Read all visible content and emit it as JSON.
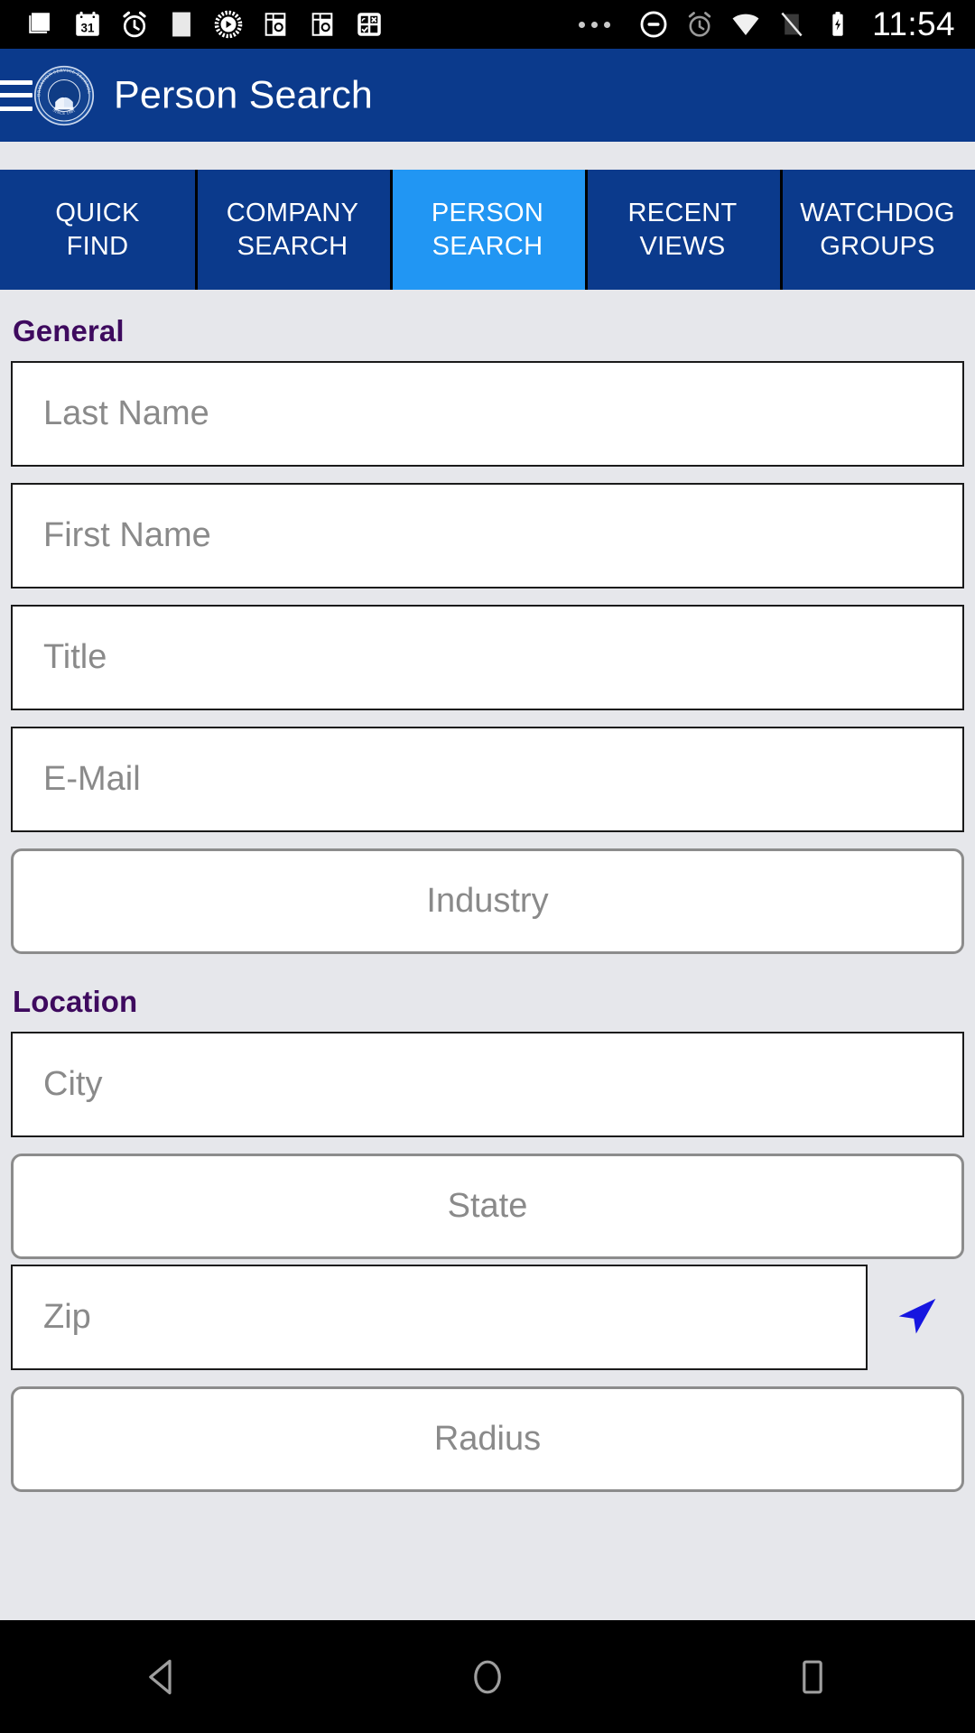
{
  "status_bar": {
    "time": "11:54",
    "left_icons": [
      "news-icon",
      "calendar-31-icon",
      "alarm-clock-icon",
      "blank-app-icon",
      "media-player-icon",
      "photo-app-icon",
      "photo-app-icon-2",
      "quad-app-icon"
    ],
    "right_icons": [
      "overflow-dots-icon",
      "do-not-disturb-icon",
      "alarm-set-icon",
      "wifi-icon",
      "no-signal-icon",
      "battery-charging-icon"
    ],
    "calendar_day": "31"
  },
  "appbar": {
    "title": "Person Search",
    "menu_icon": "hamburger-icon",
    "logo_text_outer": "INFORMATION SERVICE TECHNOLOGY",
    "logo_text_bottom": "SINCE 1981",
    "background_color": "#0b3a8c"
  },
  "tabs": [
    {
      "line1": "QUICK",
      "line2": "FIND",
      "active": false
    },
    {
      "line1": "COMPANY",
      "line2": "SEARCH",
      "active": false
    },
    {
      "line1": "PERSON",
      "line2": "SEARCH",
      "active": true
    },
    {
      "line1": "RECENT",
      "line2": "VIEWS",
      "active": false
    },
    {
      "line1": "WATCHDOG",
      "line2": "GROUPS",
      "active": false
    }
  ],
  "colors": {
    "tab_active": "#2196f3",
    "tab_inactive": "#0b3a8c",
    "section_heading": "#3e0a5e",
    "page_background": "#e6e7eb",
    "gps_arrow": "#1616e0"
  },
  "form": {
    "general": {
      "heading": "General",
      "fields": [
        {
          "name": "last-name",
          "placeholder": "Last Name",
          "value": "",
          "type": "text"
        },
        {
          "name": "first-name",
          "placeholder": "First Name",
          "value": "",
          "type": "text"
        },
        {
          "name": "title",
          "placeholder": "Title",
          "value": "",
          "type": "text"
        },
        {
          "name": "email",
          "placeholder": "E-Mail",
          "value": "",
          "type": "text"
        }
      ],
      "picker": {
        "name": "industry",
        "label": "Industry",
        "value": ""
      }
    },
    "location": {
      "heading": "Location",
      "city": {
        "placeholder": "City",
        "value": "",
        "type": "text"
      },
      "state": {
        "label": "State",
        "value": "",
        "type": "picker"
      },
      "zip": {
        "placeholder": "Zip",
        "value": "",
        "type": "text"
      },
      "gps_icon": "navigation-arrow-icon",
      "radius": {
        "label": "Radius",
        "value": "",
        "type": "picker"
      }
    }
  },
  "nav_bar": {
    "back": "back-triangle-icon",
    "home": "home-circle-icon",
    "recents": "recents-square-icon"
  }
}
